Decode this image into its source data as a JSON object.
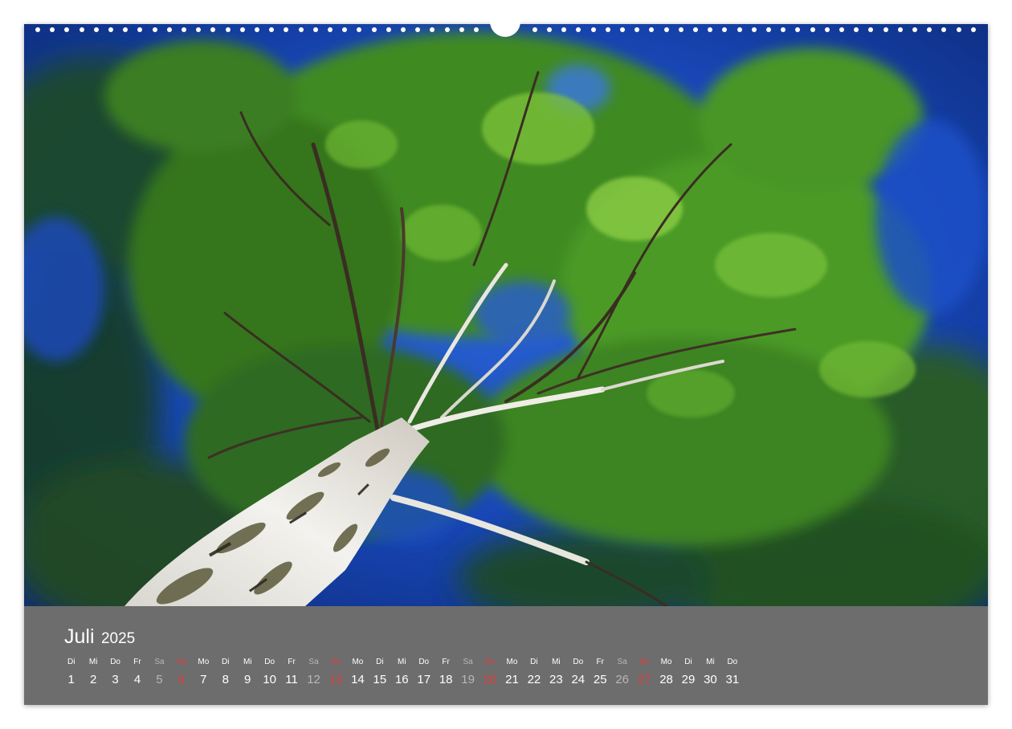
{
  "calendar": {
    "month": "Juli",
    "year": "2025",
    "days": [
      {
        "wd": "Di",
        "n": "1",
        "kind": "weekday"
      },
      {
        "wd": "Mi",
        "n": "2",
        "kind": "weekday"
      },
      {
        "wd": "Do",
        "n": "3",
        "kind": "weekday"
      },
      {
        "wd": "Fr",
        "n": "4",
        "kind": "weekday"
      },
      {
        "wd": "Sa",
        "n": "5",
        "kind": "sat"
      },
      {
        "wd": "So",
        "n": "6",
        "kind": "sun"
      },
      {
        "wd": "Mo",
        "n": "7",
        "kind": "weekday"
      },
      {
        "wd": "Di",
        "n": "8",
        "kind": "weekday"
      },
      {
        "wd": "Mi",
        "n": "9",
        "kind": "weekday"
      },
      {
        "wd": "Do",
        "n": "10",
        "kind": "weekday"
      },
      {
        "wd": "Fr",
        "n": "11",
        "kind": "weekday"
      },
      {
        "wd": "Sa",
        "n": "12",
        "kind": "sat"
      },
      {
        "wd": "So",
        "n": "13",
        "kind": "sun"
      },
      {
        "wd": "Mo",
        "n": "14",
        "kind": "weekday"
      },
      {
        "wd": "Di",
        "n": "15",
        "kind": "weekday"
      },
      {
        "wd": "Mi",
        "n": "16",
        "kind": "weekday"
      },
      {
        "wd": "Do",
        "n": "17",
        "kind": "weekday"
      },
      {
        "wd": "Fr",
        "n": "18",
        "kind": "weekday"
      },
      {
        "wd": "Sa",
        "n": "19",
        "kind": "sat"
      },
      {
        "wd": "So",
        "n": "20",
        "kind": "sun"
      },
      {
        "wd": "Mo",
        "n": "21",
        "kind": "weekday"
      },
      {
        "wd": "Di",
        "n": "22",
        "kind": "weekday"
      },
      {
        "wd": "Mi",
        "n": "23",
        "kind": "weekday"
      },
      {
        "wd": "Do",
        "n": "24",
        "kind": "weekday"
      },
      {
        "wd": "Fr",
        "n": "25",
        "kind": "weekday"
      },
      {
        "wd": "Sa",
        "n": "26",
        "kind": "sat"
      },
      {
        "wd": "So",
        "n": "27",
        "kind": "sun"
      },
      {
        "wd": "Mo",
        "n": "28",
        "kind": "weekday"
      },
      {
        "wd": "Di",
        "n": "29",
        "kind": "weekday"
      },
      {
        "wd": "Mi",
        "n": "30",
        "kind": "weekday"
      },
      {
        "wd": "Do",
        "n": "31",
        "kind": "weekday"
      }
    ]
  },
  "colors": {
    "bar": "#6d6d6d",
    "sunday": "#e23a3a",
    "saturday": "#b8b8b8",
    "sky": "#1546b8",
    "foliage": "#3f8a22"
  },
  "photo": {
    "subject": "birch-tree-canopy"
  }
}
